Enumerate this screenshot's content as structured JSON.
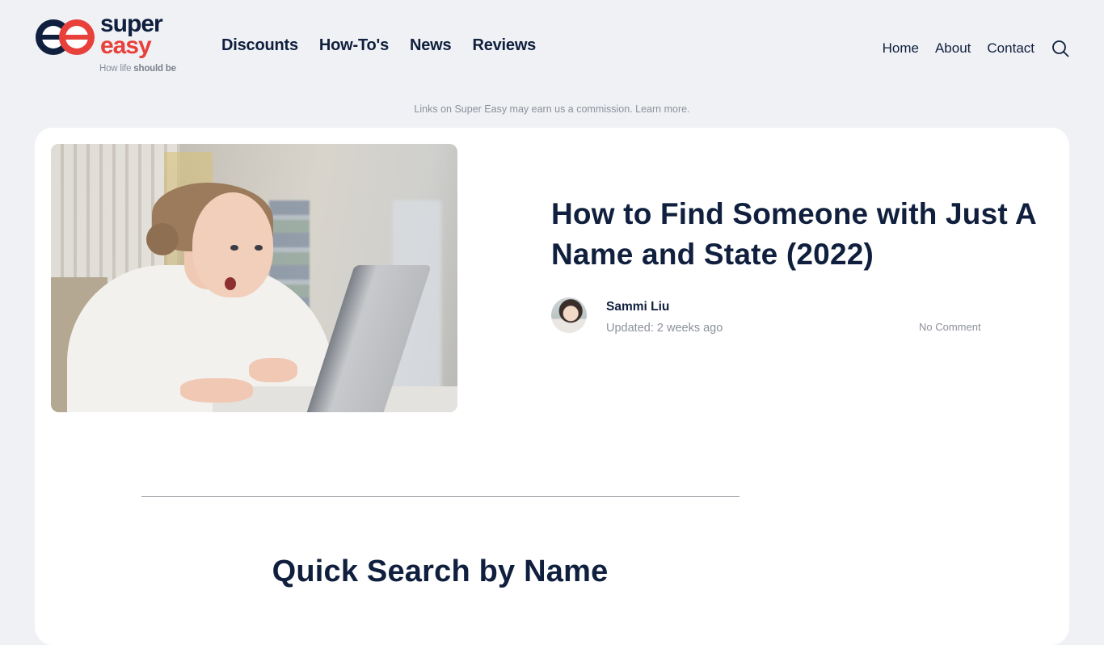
{
  "brand": {
    "word_top": "super",
    "word_bottom": "easy",
    "tagline_light": "How life ",
    "tagline_bold": "should be",
    "colors": {
      "navy": "#0f1f3d",
      "red": "#e8403a",
      "background": "#f0f1f5",
      "muted": "#8c919b"
    }
  },
  "main_nav": [
    {
      "label": "Discounts"
    },
    {
      "label": "How-To's"
    },
    {
      "label": "News"
    },
    {
      "label": "Reviews"
    }
  ],
  "right_nav": [
    {
      "label": "Home"
    },
    {
      "label": "About"
    },
    {
      "label": "Contact"
    }
  ],
  "search": {
    "icon": "search-icon"
  },
  "disclosure": "Links on Super Easy may earn us a commission. Learn more.",
  "article": {
    "hero_image_alt": "Surprised woman looking at laptop",
    "title": "How to Find Someone with Just A Name and State (2022)",
    "author": {
      "name": "Sammi Liu",
      "updated": "Updated: 2 weeks ago"
    },
    "comments": "No Comment"
  },
  "sections": [
    {
      "heading": "Quick Search by Name"
    }
  ]
}
